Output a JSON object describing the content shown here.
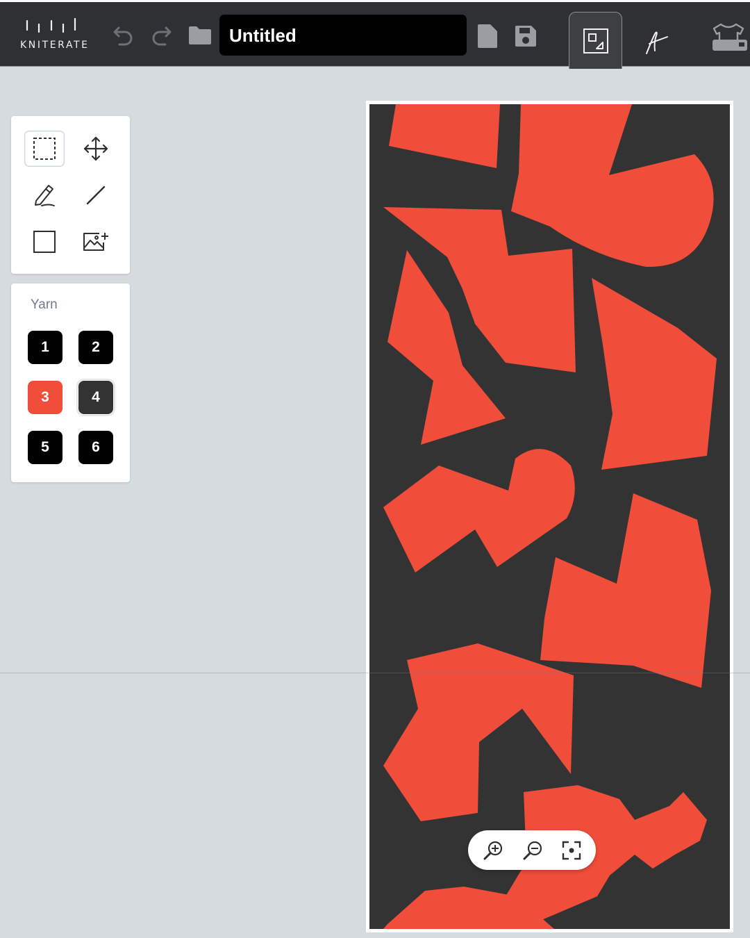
{
  "app": {
    "logo_text": "KNITERATE",
    "document_title": "Untitled"
  },
  "toolbar": {
    "icons": [
      "undo-icon",
      "redo-icon",
      "folder-icon",
      "file-icon",
      "save-icon"
    ],
    "modes": [
      "image-mode-icon",
      "stitch-mode-icon",
      "garment-mode-icon"
    ],
    "active_mode": "image-mode-icon"
  },
  "tools": {
    "items": [
      "select-icon",
      "move-icon",
      "pencil-icon",
      "line-icon",
      "rectangle-icon",
      "add-image-icon"
    ],
    "selected": "select-icon"
  },
  "yarn": {
    "title": "Yarn",
    "swatches": [
      {
        "label": "1",
        "color": "#000000"
      },
      {
        "label": "2",
        "color": "#000000"
      },
      {
        "label": "3",
        "color": "#f04e3a"
      },
      {
        "label": "4",
        "color": "#333333"
      },
      {
        "label": "5",
        "color": "#000000"
      },
      {
        "label": "6",
        "color": "#000000"
      }
    ],
    "selected": "4"
  },
  "canvas": {
    "background_color": "#333333",
    "shape_color": "#f04e3a"
  },
  "zoom": {
    "icons": [
      "zoom-in-icon",
      "zoom-out-icon",
      "fit-to-screen-icon"
    ]
  }
}
